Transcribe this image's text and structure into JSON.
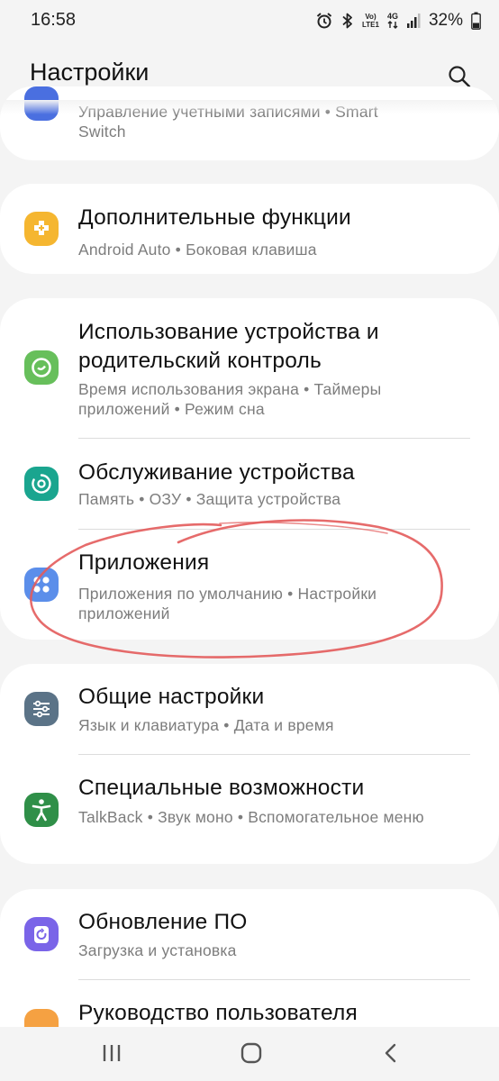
{
  "status_bar": {
    "time": "16:58",
    "volte_top": "Vo)",
    "volte_bottom": "LTE1",
    "network": "4G",
    "battery": "32%"
  },
  "header": {
    "title": "Настройки"
  },
  "items": {
    "accounts": {
      "subtitle_top": "Управление учетными записями • Smart",
      "subtitle_bottom": "Switch",
      "color": "#4a6fe0"
    },
    "advanced": {
      "title": "Дополнительные функции",
      "subtitle": "Android Auto • Боковая клавиша",
      "color": "#f5b630"
    },
    "wellbeing": {
      "title": "Использование устройства и родительский контроль",
      "subtitle": "Время использования экрана • Таймеры приложений • Режим сна",
      "color": "#67bf5b"
    },
    "care": {
      "title": "Обслуживание устройства",
      "subtitle": "Память • ОЗУ • Защита устройства",
      "color": "#1aa58f"
    },
    "apps": {
      "title": "Приложения",
      "subtitle": "Приложения по умолчанию • Настройки приложений",
      "color": "#5b8eea"
    },
    "general": {
      "title": "Общие настройки",
      "subtitle": "Язык и клавиатура • Дата и время",
      "color": "#5b7387"
    },
    "accessibility": {
      "title": "Специальные возможности",
      "subtitle": "TalkBack • Звук моно • Вспомогательное меню",
      "color": "#2f8f48"
    },
    "update": {
      "title": "Обновление ПО",
      "subtitle": "Загрузка и установка",
      "color": "#7a64e8"
    },
    "manual": {
      "title": "Руководство пользователя",
      "color": "#f5a142"
    }
  },
  "annotation_color": "#e35b5b"
}
